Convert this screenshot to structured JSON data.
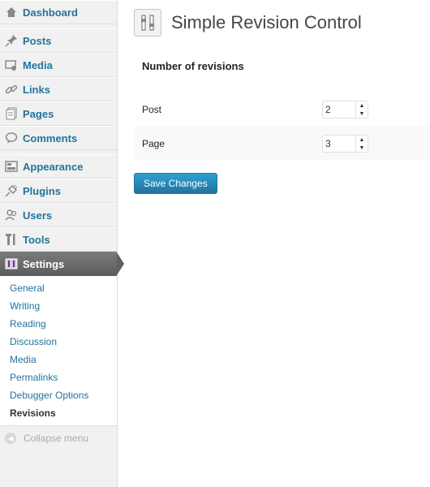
{
  "sidebar": {
    "top": [
      {
        "label": "Dashboard",
        "icon": "dashboard-icon"
      }
    ],
    "group1": [
      {
        "label": "Posts",
        "icon": "posts-pin-icon"
      },
      {
        "label": "Media",
        "icon": "media-icon"
      },
      {
        "label": "Links",
        "icon": "links-icon"
      },
      {
        "label": "Pages",
        "icon": "pages-icon"
      },
      {
        "label": "Comments",
        "icon": "comments-icon"
      }
    ],
    "group2": [
      {
        "label": "Appearance",
        "icon": "appearance-icon"
      },
      {
        "label": "Plugins",
        "icon": "plugins-icon"
      },
      {
        "label": "Users",
        "icon": "users-icon"
      },
      {
        "label": "Tools",
        "icon": "tools-icon"
      },
      {
        "label": "Settings",
        "icon": "settings-icon"
      }
    ],
    "submenu": [
      {
        "label": "General"
      },
      {
        "label": "Writing"
      },
      {
        "label": "Reading"
      },
      {
        "label": "Discussion"
      },
      {
        "label": "Media"
      },
      {
        "label": "Permalinks"
      },
      {
        "label": "Debugger Options"
      },
      {
        "label": "Revisions",
        "active": true
      }
    ],
    "collapse_label": "Collapse menu"
  },
  "page": {
    "title": "Simple Revision Control",
    "section_title": "Number of revisions",
    "fields": [
      {
        "label": "Post",
        "value": "2"
      },
      {
        "label": "Page",
        "value": "3"
      }
    ],
    "save_label": "Save Changes"
  },
  "colors": {
    "link": "#21759b",
    "current_bg": "#606060",
    "button": "#21759b"
  }
}
